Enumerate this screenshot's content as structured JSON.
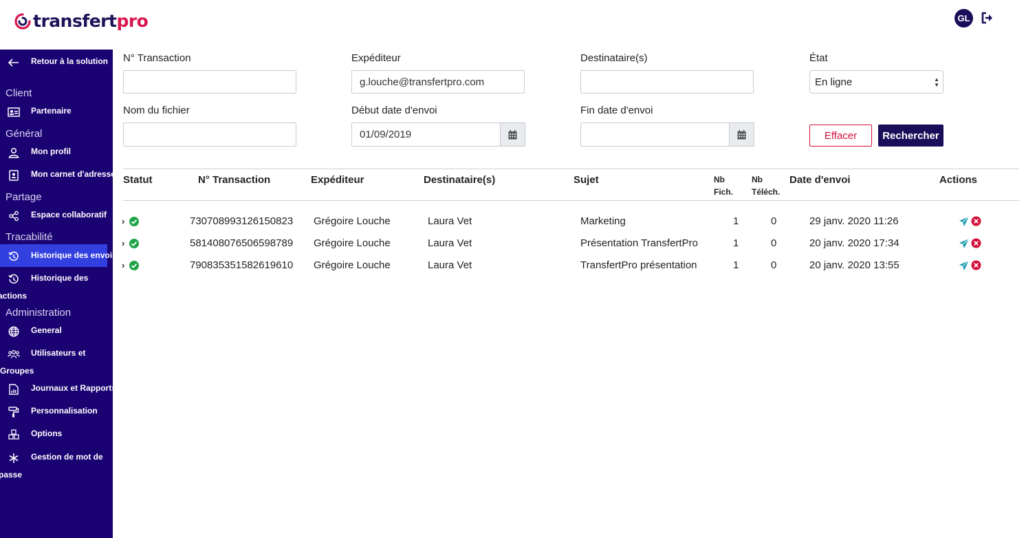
{
  "header": {
    "logo_part1": "transfert",
    "logo_part2": "pro",
    "avatar_initials": "GL",
    "logout_icon": "sign-out-icon"
  },
  "sidebar": {
    "back_label": "Retour à la solution",
    "sections": {
      "client": "Client",
      "general": "Général",
      "partage": "Partage",
      "tracabilite": "Tracabilité",
      "administration": "Administration"
    },
    "items": {
      "partenaire": "Partenaire",
      "mon_profil": "Mon profil",
      "carnet": "Mon carnet d'adresse",
      "espace": "Espace collaboratif",
      "historique_envois": "Historique des envois",
      "historique_actions_1": "Historique des",
      "historique_actions_2": "actions",
      "general": "General",
      "utilisateurs_1": "Utilisateurs et",
      "utilisateurs_2": "Groupes",
      "journaux": "Journaux et Rapports",
      "personnalisation": "Personnalisation",
      "options": "Options",
      "mdp_1": "Gestion de mot de",
      "mdp_2": "passe"
    }
  },
  "filters": {
    "transaction_label": "N° Transaction",
    "transaction_value": "",
    "expediteur_label": "Expéditeur",
    "expediteur_value": "g.louche@transfertpro.com",
    "destinataires_label": "Destinataire(s)",
    "destinataires_value": "",
    "etat_label": "État",
    "etat_value": "En ligne",
    "fichier_label": "Nom du fichier",
    "fichier_value": "",
    "debut_label": "Début date d'envoi",
    "debut_value": "01/09/2019",
    "fin_label": "Fin date d'envoi",
    "fin_value": "",
    "clear_label": "Effacer",
    "search_label": "Rechercher"
  },
  "table": {
    "headers": {
      "statut": "Statut",
      "transaction": "N° Transaction",
      "expediteur": "Expéditeur",
      "destinataires": "Destinataire(s)",
      "sujet": "Sujet",
      "nb_fich_1": "Nb",
      "nb_fich_2": "Fich.",
      "nb_telech_1": "Nb",
      "nb_telech_2": "Téléch.",
      "date": "Date d'envoi",
      "actions": "Actions"
    },
    "rows": [
      {
        "transaction": "730708993126150823",
        "expediteur": "Grégoire Louche",
        "destinataires": "Laura Vet",
        "sujet": "Marketing",
        "nb_fich": "1",
        "nb_telech": "0",
        "date": "29 janv. 2020 11:26"
      },
      {
        "transaction": "581408076506598789",
        "expediteur": "Grégoire Louche",
        "destinataires": "Laura Vet",
        "sujet": "Présentation TransfertPro",
        "nb_fich": "1",
        "nb_telech": "0",
        "date": "20 janv. 2020 17:34"
      },
      {
        "transaction": "790835351582619610",
        "expediteur": "Grégoire Louche",
        "destinataires": "Laura Vet",
        "sujet": "TransfertPro présentation",
        "nb_fich": "1",
        "nb_telech": "0",
        "date": "20 janv. 2020 13:55"
      }
    ]
  },
  "colors": {
    "sidebar_bg": "#1a0273",
    "active_item": "#3340e0",
    "brand_red": "#d8164f",
    "primary_dark": "#1a0d5a",
    "success": "#1ea446",
    "send_icon": "#1b9bb0",
    "delete_icon": "#d3103a"
  }
}
